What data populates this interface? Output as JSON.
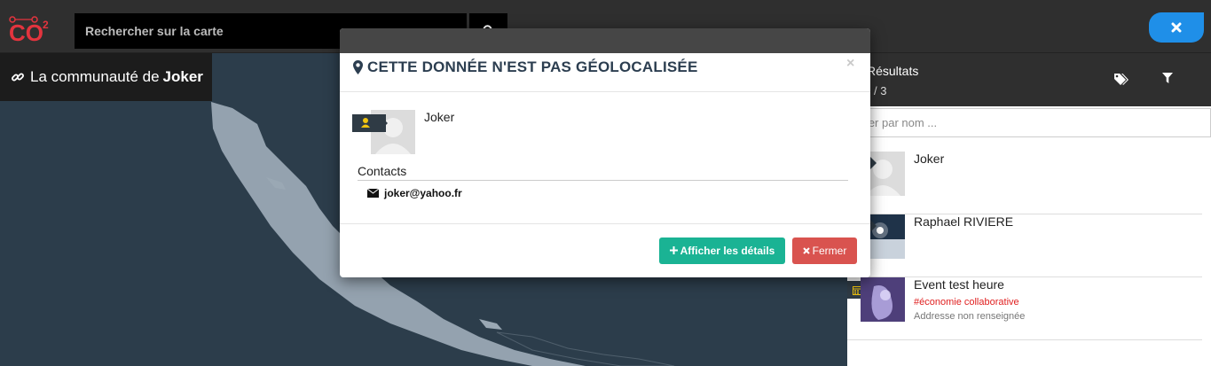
{
  "search": {
    "placeholder": "Rechercher sur la carte"
  },
  "community": {
    "prefix": "La communauté de",
    "name": "Joker"
  },
  "results_panel": {
    "title": "Résultats",
    "count": "/ 3",
    "filter_placeholder": "ltrer par nom ...",
    "items": [
      {
        "name": "Joker",
        "tag": "",
        "address": ""
      },
      {
        "name": "Raphael RIVIERE",
        "tag": "",
        "address": ""
      },
      {
        "name": "Event test heure",
        "tag": "#économie collaborative",
        "address": "Addresse non renseignée"
      }
    ]
  },
  "modal": {
    "title": "CETTE DONNÉE N'EST PAS GÉOLOCALISÉE",
    "close_glyph": "×",
    "name": "Joker",
    "contacts_label": "Contacts",
    "email": "joker@yahoo.fr",
    "details_label": "Afficher les détails",
    "fermer_label": "Fermer"
  },
  "colors": {
    "accent_blue": "#1f8fe8",
    "details_green": "#1ab394",
    "fermer_red": "#d9534f",
    "logo_red": "#e3343e",
    "badge_yellow": "#f1c40f"
  }
}
